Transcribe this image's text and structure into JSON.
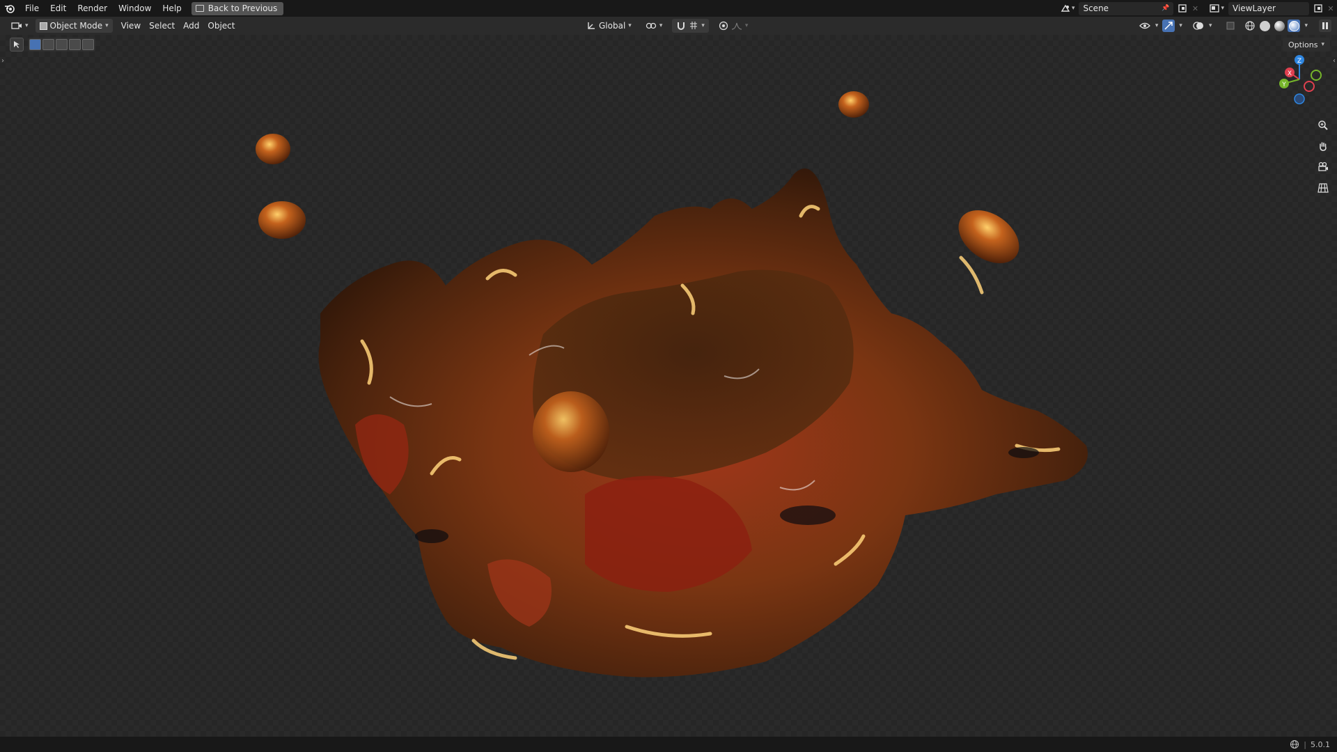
{
  "menu": {
    "file": "File",
    "edit": "Edit",
    "render": "Render",
    "window": "Window",
    "help": "Help",
    "back_to_previous": "Back to Previous"
  },
  "top_right": {
    "scene": "Scene",
    "view_layer": "ViewLayer"
  },
  "viewport_header": {
    "mode": "Object Mode",
    "view": "View",
    "select": "Select",
    "add": "Add",
    "object": "Object",
    "orientation": "Global"
  },
  "viewport": {
    "options_label": "Options",
    "gizmo_axes": {
      "x": "X",
      "y": "Y",
      "z": "Z"
    }
  },
  "status": {
    "version": "5.0.1"
  },
  "colors": {
    "accent": "#4772b3",
    "axis_x": "#e0404f",
    "axis_y": "#76b52a",
    "axis_z": "#2f86e0"
  }
}
